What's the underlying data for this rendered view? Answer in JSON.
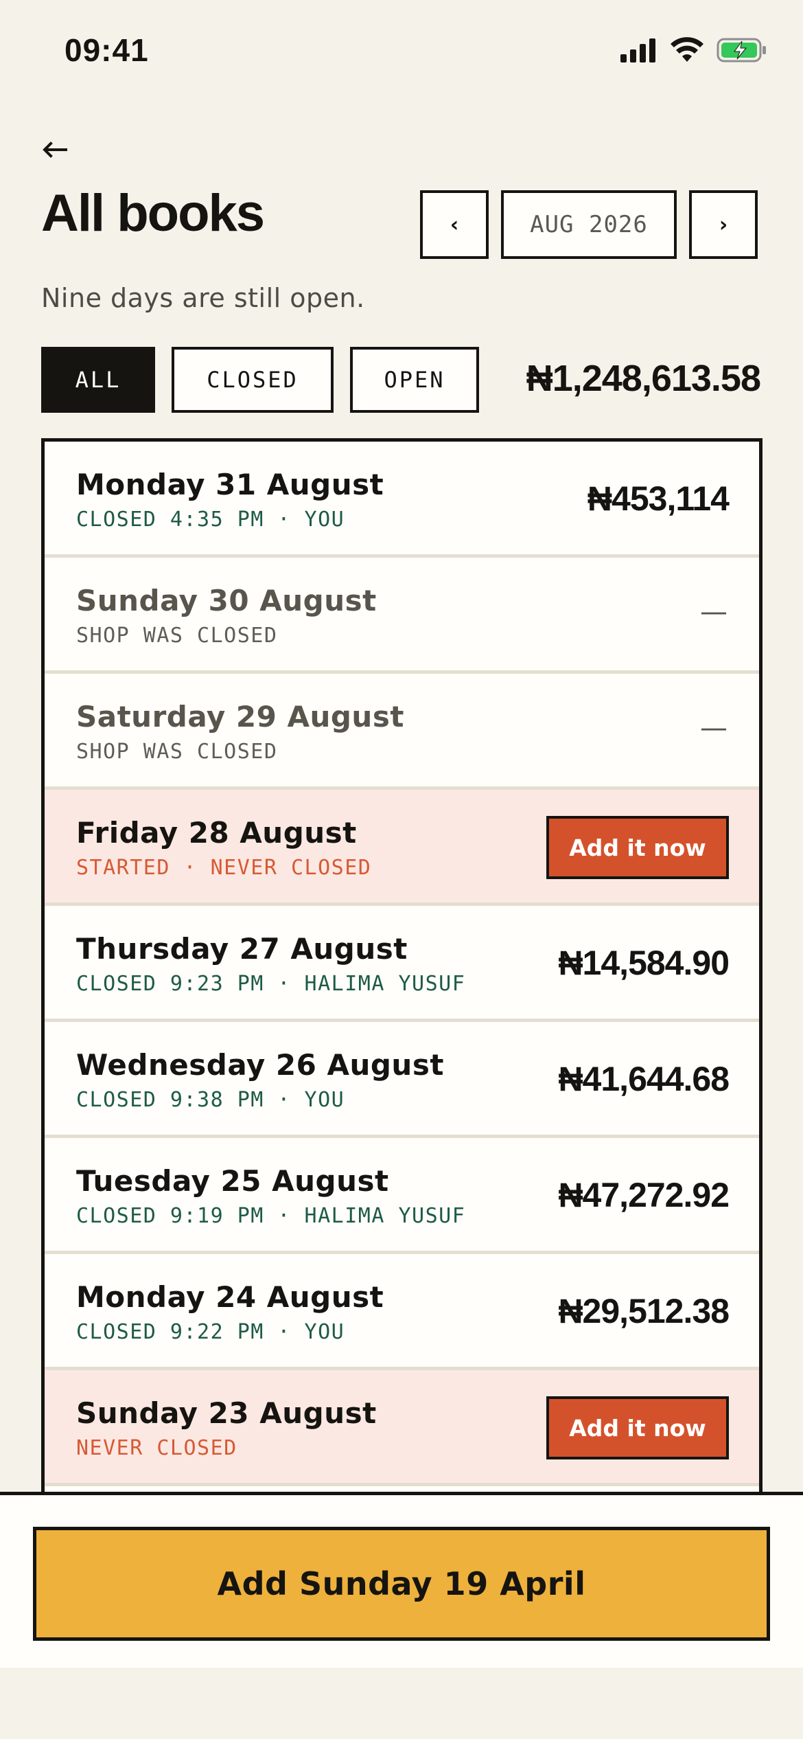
{
  "status": {
    "time": "09:41",
    "icons": [
      "signal-icon",
      "wifi-icon",
      "battery-charging-icon"
    ],
    "battery_color": "#34c759"
  },
  "header": {
    "back_icon": "arrow-left-icon",
    "title": "All books",
    "subtitle": "Nine days are still open.",
    "month_prev": "‹",
    "month_label": "AUG 2026",
    "month_next": "›"
  },
  "filters": {
    "options": [
      "ALL",
      "CLOSED",
      "OPEN"
    ],
    "selected": "ALL",
    "total": "₦1,248,613.58"
  },
  "books": [
    {
      "date": "Monday 31 August",
      "meta": "CLOSED 4:35 PM · YOU",
      "amount": "₦453,114",
      "state": "closed"
    },
    {
      "date": "Sunday 30 August",
      "meta": "SHOP WAS CLOSED",
      "amount": "—",
      "state": "off"
    },
    {
      "date": "Saturday 29 August",
      "meta": "SHOP WAS CLOSED",
      "amount": "—",
      "state": "off"
    },
    {
      "date": "Friday 28 August",
      "meta": "STARTED · NEVER CLOSED",
      "action": "Add it now",
      "state": "missing"
    },
    {
      "date": "Thursday 27 August",
      "meta": "CLOSED 9:23 PM · HALIMA YUSUF",
      "amount": "₦14,584.90",
      "state": "closed"
    },
    {
      "date": "Wednesday 26 August",
      "meta": "CLOSED 9:38 PM · YOU",
      "amount": "₦41,644.68",
      "state": "closed"
    },
    {
      "date": "Tuesday 25 August",
      "meta": "CLOSED 9:19 PM · HALIMA YUSUF",
      "amount": "₦47,272.92",
      "state": "closed"
    },
    {
      "date": "Monday 24 August",
      "meta": "CLOSED 9:22 PM · YOU",
      "amount": "₦29,512.38",
      "state": "closed"
    },
    {
      "date": "Sunday 23 August",
      "meta": "NEVER CLOSED",
      "action": "Add it now",
      "state": "missing"
    }
  ],
  "footer": {
    "primary_action": "Add Sunday 19 April"
  },
  "colors": {
    "background": "#f5f2ea",
    "ink": "#151411",
    "closed_meta": "#1e5b46",
    "missing_bg": "#fce8e2",
    "missing_accent": "#d4522b",
    "primary": "#eeb13c"
  }
}
